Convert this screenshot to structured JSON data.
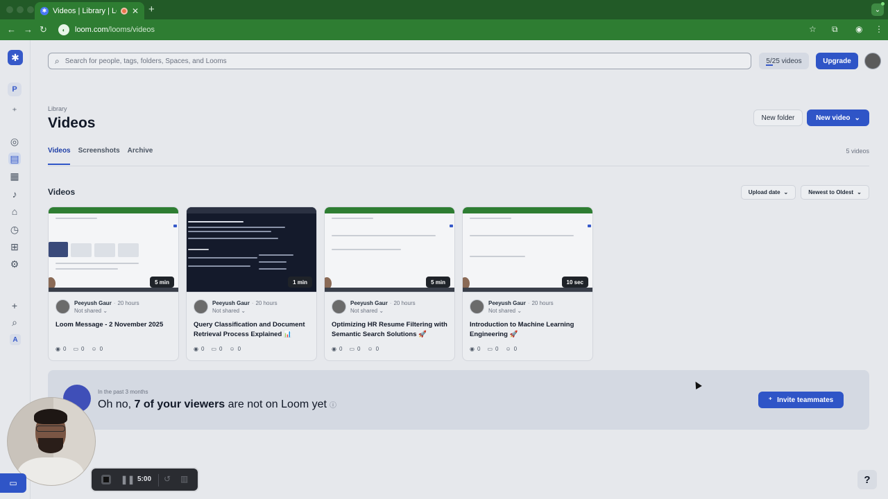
{
  "browser": {
    "tab_title": "Videos | Library | Loom",
    "new_tab": "+",
    "url_domain": "loom.com",
    "url_path": "/looms/videos"
  },
  "sidebar": {
    "workspace_initial": "P",
    "bottom_initial": "A"
  },
  "search": {
    "placeholder": "Search for people, tags, folders, Spaces, and Looms"
  },
  "header": {
    "video_quota": "5/25 videos",
    "quota_fraction": 0.2,
    "upgrade_label": "Upgrade",
    "breadcrumb": "Library",
    "title": "Videos",
    "new_folder_label": "New folder",
    "new_video_label": "New video"
  },
  "tabs": {
    "videos": "Videos",
    "screenshots": "Screenshots",
    "archive": "Archive",
    "total": "5 videos"
  },
  "section": {
    "title": "Videos",
    "sort_field": "Upload date",
    "sort_order": "Newest to Oldest"
  },
  "cards": [
    {
      "duration": "5 min",
      "owner": "Peeyush Gaur",
      "time": "20 hours",
      "share": "Not shared",
      "title": "Loom Message - 2 November 2025",
      "views": "0",
      "comments": "0",
      "reactions": "0"
    },
    {
      "duration": "1 min",
      "owner": "Peeyush Gaur",
      "time": "20 hours",
      "share": "Not shared",
      "title": "Query Classification and Document Retrieval Process Explained 📊",
      "views": "0",
      "comments": "0",
      "reactions": "0"
    },
    {
      "duration": "5 min",
      "owner": "Peeyush Gaur",
      "time": "20 hours",
      "share": "Not shared",
      "title": "Optimizing HR Resume Filtering with Semantic Search Solutions 🚀",
      "views": "0",
      "comments": "0",
      "reactions": "0"
    },
    {
      "duration": "10 sec",
      "owner": "Peeyush Gaur",
      "time": "20 hours",
      "share": "Not shared",
      "title": "Introduction to Machine Learning Engineering 🚀",
      "views": "0",
      "comments": "0",
      "reactions": "0"
    }
  ],
  "banner": {
    "kicker": "In the past 3 months",
    "head_prefix": "Oh no, ",
    "head_bold": "7 of your viewers",
    "head_suffix": " are not on Loom yet",
    "invite_label": "Invite teammates"
  },
  "recorder": {
    "time": "5:00"
  },
  "help_label": "?"
}
